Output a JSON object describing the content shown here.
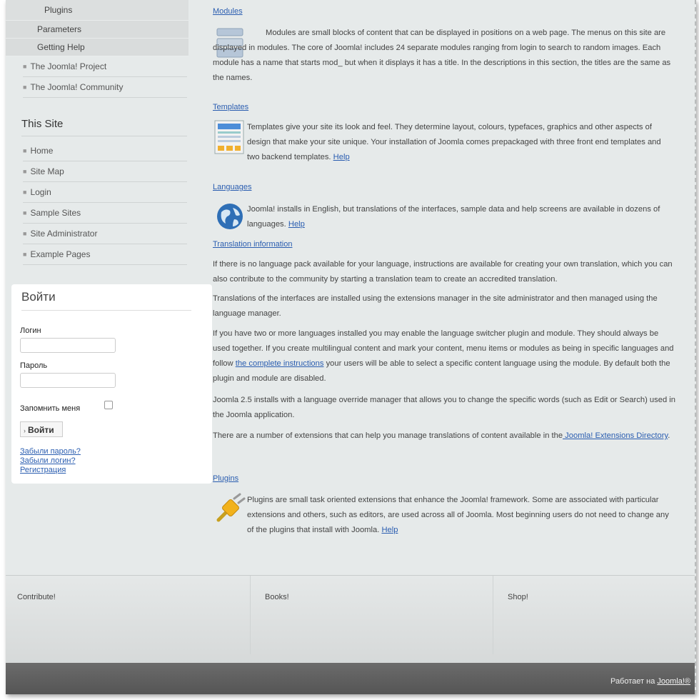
{
  "sidebar": {
    "submenu": [
      "Plugins",
      "Parameters",
      "Getting Help"
    ],
    "top_items": [
      "The Joomla! Project",
      "The Joomla! Community"
    ],
    "this_site_title": "This Site",
    "this_site_items": [
      "Home",
      "Site Map",
      "Login",
      "Sample Sites",
      "Site Administrator",
      "Example Pages"
    ]
  },
  "login": {
    "title": "Войти",
    "username_label": "Логин",
    "password_label": "Пароль",
    "remember_label": "Запомнить меня",
    "submit_label": "Войти",
    "forgot_password": "Забыли пароль?",
    "forgot_login": "Забыли логин?",
    "register": "Регистрация"
  },
  "content": {
    "modules_title": "Modules",
    "modules_text": "Modules are small blocks of content that can be displayed in positions on a web page. The menus on this site are displayed in modules. The core of Joomla! includes 24 separate modules ranging from login to search to random images. Each module has a name that starts mod_ but when it displays it has a title. In the descriptions in this section, the titles are the same as the names.",
    "templates_title": "Templates",
    "templates_text": "Templates give your site its look and feel. They determine layout, colours, typefaces, graphics and other aspects of design that make your site unique. Your installation of Joomla comes prepackaged with three front end templates and two backend templates.",
    "help_link": "Help",
    "languages_title": "Languages",
    "languages_text": "Joomla! installs in English, but translations of the interfaces, sample data and help screens are available in dozens of languages.",
    "translation_title": "Translation information",
    "translation_p1": "If there is no language pack available for your language, instructions are available for creating your own translation, which you can also contribute to the community by starting a translation team to create an accredited translation.",
    "translation_p2": "Translations of the interfaces are installed using the extensions manager in the site administrator and then managed using the language manager.",
    "translation_p3_a": "If you have two or more languages installed you may enable the language switcher plugin and module. They should always be used together. If you create multilingual content and mark your content, menu items or modules as being in specific languages and follow ",
    "translation_p3_link": "the complete instructions",
    "translation_p3_b": " your users will be able to select a specific content language using the module. By default both the plugin and module are disabled.",
    "translation_p4": "Joomla 2.5 installs with a language override manager that allows you to change the specific words (such as Edit or Search) used in the Joomla application.",
    "translation_p5_a": "There are a number of extensions that can help you manage translations of content available in the",
    "translation_p5_link": " Joomla! Extensions Directory",
    "translation_p5_b": ".",
    "plugins_title": "Plugins",
    "plugins_text": "Plugins are small task oriented extensions that enhance the Joomla! framework. Some are associated with particular extensions and others, such as editors, are used across all of Joomla. Most beginning users do not need to change any of the plugins that install with Joomla."
  },
  "footer": {
    "col1": "Contribute!",
    "col2": "Books!",
    "col3": "Shop!",
    "powered_prefix": "Работает на ",
    "powered_link": "Joomla!®"
  }
}
